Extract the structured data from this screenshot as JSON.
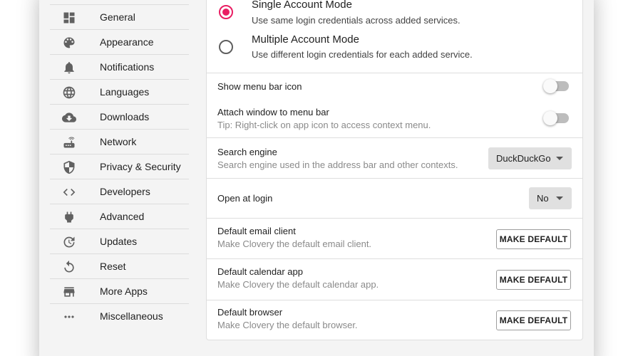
{
  "sidebar": {
    "items": [
      {
        "label": "General",
        "icon": "dashboard-icon"
      },
      {
        "label": "Appearance",
        "icon": "palette-icon"
      },
      {
        "label": "Notifications",
        "icon": "bell-icon"
      },
      {
        "label": "Languages",
        "icon": "globe-icon"
      },
      {
        "label": "Downloads",
        "icon": "cloud-download-icon"
      },
      {
        "label": "Network",
        "icon": "router-icon"
      },
      {
        "label": "Privacy & Security",
        "icon": "shield-icon"
      },
      {
        "label": "Developers",
        "icon": "code-icon"
      },
      {
        "label": "Advanced",
        "icon": "plug-icon"
      },
      {
        "label": "Updates",
        "icon": "update-icon"
      },
      {
        "label": "Reset",
        "icon": "reset-icon"
      },
      {
        "label": "More Apps",
        "icon": "store-icon"
      },
      {
        "label": "Miscellaneous",
        "icon": "more-horiz-icon"
      }
    ]
  },
  "account_mode": {
    "selected": "single",
    "single": {
      "title": "Single Account Mode",
      "description": "Use same login credentials across added services."
    },
    "multiple": {
      "title": "Multiple Account Mode",
      "description": "Use different login credentials for each added service."
    }
  },
  "menu_bar": {
    "show_icon": {
      "title": "Show menu bar icon",
      "enabled": false
    },
    "attach_window": {
      "title": "Attach window to menu bar",
      "description": "Tip: Right-click on app icon to access context menu.",
      "enabled": false
    }
  },
  "search_engine": {
    "title": "Search engine",
    "description": "Search engine used in the address bar and other contexts.",
    "value": "DuckDuckGo"
  },
  "open_at_login": {
    "title": "Open at login",
    "value": "No"
  },
  "defaults": {
    "email": {
      "title": "Default email client",
      "description": "Make Clovery the default email client.",
      "button": "MAKE DEFAULT"
    },
    "calendar": {
      "title": "Default calendar app",
      "description": "Make Clovery the default calendar app.",
      "button": "MAKE DEFAULT"
    },
    "browser": {
      "title": "Default browser",
      "description": "Make Clovery the default browser.",
      "button": "MAKE DEFAULT"
    }
  },
  "colors": {
    "accent": "#e91e63",
    "toggle_off_track": "#bdbdbd",
    "select_bg": "#e0e0e0"
  }
}
